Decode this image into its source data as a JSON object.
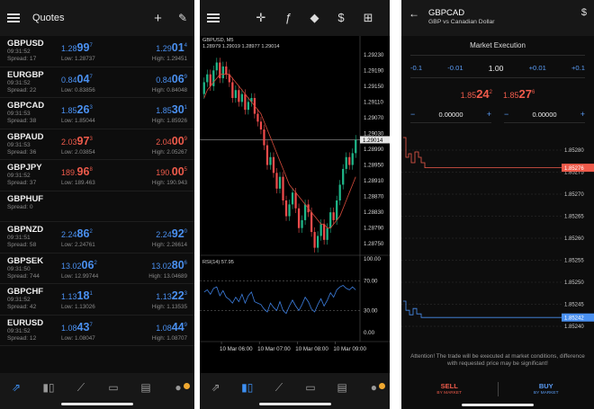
{
  "colors": {
    "up": "#4a90f0",
    "down": "#ef5b4b",
    "background": "#000000",
    "accent": "#3d8ff2",
    "badge": "#f0a830"
  },
  "quotes_screen": {
    "title": "Quotes",
    "icons": [
      "menu-icon",
      "plus-icon",
      "pencil-icon"
    ],
    "rows": [
      {
        "symbol": "GBPUSD",
        "time": "09:31:52",
        "spread": "Spread: 17",
        "bid_main": "1.28",
        "bid_big": "99",
        "bid_sup": "7",
        "ask_main": "1.29",
        "ask_big": "01",
        "ask_sup": "4",
        "low": "Low: 1.28737",
        "high": "High: 1.29451",
        "dir": "up"
      },
      {
        "symbol": "EURGBP",
        "time": "09:31:52",
        "spread": "Spread: 22",
        "bid_main": "0.84",
        "bid_big": "04",
        "bid_sup": "7",
        "ask_main": "0.84",
        "ask_big": "06",
        "ask_sup": "9",
        "low": "Low: 0.83856",
        "high": "High: 0.84048",
        "dir": "up"
      },
      {
        "symbol": "GBPCAD",
        "time": "09:31:53",
        "spread": "Spread: 38",
        "bid_main": "1.85",
        "bid_big": "26",
        "bid_sup": "3",
        "ask_main": "1.85",
        "ask_big": "30",
        "ask_sup": "1",
        "low": "Low: 1.85044",
        "high": "High: 1.85926",
        "dir": "up"
      },
      {
        "symbol": "GBPAUD",
        "time": "09:31:53",
        "spread": "Spread: 36",
        "bid_main": "2.03",
        "bid_big": "97",
        "bid_sup": "3",
        "ask_main": "2.04",
        "ask_big": "00",
        "ask_sup": "9",
        "low": "Low: 2.03854",
        "high": "High: 2.05267",
        "dir": "down"
      },
      {
        "symbol": "GBPJPY",
        "time": "09:31:52",
        "spread": "Spread: 37",
        "bid_main": "189.",
        "bid_big": "96",
        "bid_sup": "8",
        "ask_main": "190.",
        "ask_big": "00",
        "ask_sup": "5",
        "low": "Low: 189.463",
        "high": "High: 190.943",
        "dir": "down"
      },
      {
        "symbol": "GBPHUF",
        "time": "",
        "spread": "Spread: 0",
        "bid_main": "",
        "bid_big": "",
        "bid_sup": "",
        "ask_main": "",
        "ask_big": "",
        "ask_sup": "",
        "low": "",
        "high": "",
        "dir": "up"
      },
      {
        "symbol": "GBPNZD",
        "time": "09:31:51",
        "spread": "Spread: 58",
        "bid_main": "2.24",
        "bid_big": "86",
        "bid_sup": "2",
        "ask_main": "2.24",
        "ask_big": "92",
        "ask_sup": "0",
        "low": "Low: 2.24761",
        "high": "High: 2.26614",
        "dir": "up"
      },
      {
        "symbol": "GBPSEK",
        "time": "09:31:50",
        "spread": "Spread: 744",
        "bid_main": "13.02",
        "bid_big": "06",
        "bid_sup": "2",
        "ask_main": "13.02",
        "ask_big": "80",
        "ask_sup": "6",
        "low": "Low: 12.99744",
        "high": "High: 13.04689",
        "dir": "up"
      },
      {
        "symbol": "GBPCHF",
        "time": "09:31:52",
        "spread": "Spread: 42",
        "bid_main": "1.13",
        "bid_big": "18",
        "bid_sup": "1",
        "ask_main": "1.13",
        "ask_big": "22",
        "ask_sup": "3",
        "low": "Low: 1.13026",
        "high": "High: 1.13535",
        "dir": "up"
      },
      {
        "symbol": "EURUSD",
        "time": "09:31:52",
        "spread": "Spread: 12",
        "bid_main": "1.08",
        "bid_big": "43",
        "bid_sup": "7",
        "ask_main": "1.08",
        "ask_big": "44",
        "ask_sup": "9",
        "low": "Low: 1.08047",
        "high": "High: 1.08707",
        "dir": "up"
      }
    ],
    "nav": [
      "trade-icon",
      "candles-icon",
      "chart-line-icon",
      "inbox-icon",
      "news-icon",
      "chat-icon"
    ]
  },
  "chart_screen": {
    "icons": [
      "menu-icon",
      "crosshair-icon",
      "function-icon",
      "shapes-icon",
      "dollar-swap-icon",
      "new-order-icon"
    ],
    "symbol_label": "GBPUSD, M5",
    "ohlc_label": "1.28979 1.29019 1.28977 1.29014",
    "rsi_label": "RSI(14) 57.95",
    "price_ticks": [
      "1.29230",
      "1.29190",
      "1.29150",
      "1.29110",
      "1.29070",
      "1.29030",
      "1.28990",
      "1.28950",
      "1.28910",
      "1.28870",
      "1.28830",
      "1.28790",
      "1.28750"
    ],
    "current_price": "1.29014",
    "rsi_ticks": [
      "100.00",
      "70.00",
      "30.00",
      "0.00"
    ],
    "time_ticks": [
      "10 Mar 06:00",
      "10 Mar 07:00",
      "10 Mar 08:00",
      "10 Mar 09:00"
    ],
    "nav": [
      "trade-icon",
      "candles-icon",
      "chart-line-icon",
      "inbox-icon",
      "news-icon",
      "chat-icon"
    ]
  },
  "chart_data": {
    "type": "candlestick",
    "x": [
      "05:30",
      "05:35",
      "05:40",
      "05:45",
      "05:50",
      "05:55",
      "06:00",
      "06:05",
      "06:10",
      "06:15",
      "06:20",
      "06:25",
      "06:30",
      "06:35",
      "06:40",
      "06:45",
      "06:50",
      "06:55",
      "07:00",
      "07:05",
      "07:10",
      "07:15",
      "07:20",
      "07:25",
      "07:30",
      "07:35",
      "07:40",
      "07:45",
      "07:50",
      "07:55",
      "08:00",
      "08:05",
      "08:10",
      "08:15",
      "08:20",
      "08:25",
      "08:30",
      "08:35",
      "08:40",
      "08:45",
      "08:50",
      "08:55",
      "09:00",
      "09:05",
      "09:10",
      "09:15",
      "09:20",
      "09:25",
      "09:30"
    ],
    "open": [
      1.2913,
      1.2916,
      1.2918,
      1.2915,
      1.2919,
      1.2921,
      1.2917,
      1.292,
      1.2918,
      1.2916,
      1.2912,
      1.2914,
      1.2911,
      1.2913,
      1.2909,
      1.2911,
      1.2912,
      1.2908,
      1.2906,
      1.2904,
      1.29,
      1.2895,
      1.2897,
      1.2893,
      1.2889,
      1.2892,
      1.2886,
      1.2882,
      1.2885,
      1.2888,
      1.2884,
      1.2879,
      1.2881,
      1.2885,
      1.2883,
      1.2878,
      1.2874,
      1.2877,
      1.288,
      1.2876,
      1.2879,
      1.2883,
      1.2881,
      1.2886,
      1.289,
      1.2894,
      1.2897,
      1.2895,
      1.2898
    ],
    "close": [
      1.2916,
      1.2918,
      1.2915,
      1.2919,
      1.2921,
      1.2917,
      1.292,
      1.2918,
      1.2916,
      1.2912,
      1.2914,
      1.2911,
      1.2913,
      1.2909,
      1.2911,
      1.2912,
      1.2908,
      1.2906,
      1.2904,
      1.29,
      1.2895,
      1.2897,
      1.2893,
      1.2889,
      1.2892,
      1.2886,
      1.2882,
      1.2885,
      1.2888,
      1.2884,
      1.2879,
      1.2881,
      1.2885,
      1.2883,
      1.2878,
      1.2874,
      1.2877,
      1.288,
      1.2876,
      1.2879,
      1.2883,
      1.2881,
      1.2886,
      1.289,
      1.2894,
      1.2897,
      1.2895,
      1.2898,
      1.29014
    ],
    "ma": [
      1.2912,
      1.2914,
      1.2915,
      1.2916,
      1.2917,
      1.2918,
      1.2918,
      1.2918,
      1.2918,
      1.2917,
      1.2916,
      1.2915,
      1.2914,
      1.2913,
      1.2912,
      1.2911,
      1.291,
      1.2909,
      1.2908,
      1.2906,
      1.2904,
      1.2902,
      1.29,
      1.2898,
      1.2896,
      1.2894,
      1.2892,
      1.289,
      1.2889,
      1.2888,
      1.2887,
      1.2886,
      1.2885,
      1.2884,
      1.2883,
      1.2882,
      1.2881,
      1.288,
      1.288,
      1.2879,
      1.2879,
      1.288,
      1.2881,
      1.2882,
      1.2884,
      1.2886,
      1.2888,
      1.289,
      1.2892
    ],
    "rsi": [
      55,
      58,
      52,
      60,
      62,
      50,
      57,
      48,
      45,
      40,
      48,
      42,
      52,
      40,
      50,
      55,
      42,
      40,
      38,
      32,
      28,
      40,
      34,
      30,
      42,
      30,
      26,
      36,
      44,
      36,
      30,
      38,
      48,
      42,
      32,
      28,
      38,
      46,
      36,
      44,
      54,
      48,
      58,
      62,
      64,
      60,
      58,
      62,
      57.95
    ],
    "ylim": [
      1.2873,
      1.2925
    ],
    "rsi_ylim": [
      0,
      100
    ]
  },
  "order_screen": {
    "symbol": "GBPCAD",
    "description": "GBP vs Canadian Dollar",
    "execution": "Market Execution",
    "volume_steps": [
      "-0.1",
      "-0.01",
      "1.00",
      "+0.01",
      "+0.1"
    ],
    "bid_main": "1.85",
    "bid_big": "24",
    "bid_sup": "2",
    "ask_main": "1.85",
    "ask_big": "27",
    "ask_sup": "6",
    "sl_value": "0.00000",
    "tp_value": "0.00000",
    "tick_labels": [
      "1.85280",
      "1.85275",
      "1.85270",
      "1.85265",
      "1.85260",
      "1.85255",
      "1.85250",
      "1.85245",
      "1.85240"
    ],
    "ask_marker": "1.85276",
    "bid_marker": "1.85242",
    "warning": "Attention! The trade will be executed at market conditions, difference with requested price may be significant!",
    "sell_label": "SELL",
    "sell_sub": "BY MARKET",
    "buy_label": "BUY",
    "buy_sub": "BY MARKET"
  }
}
